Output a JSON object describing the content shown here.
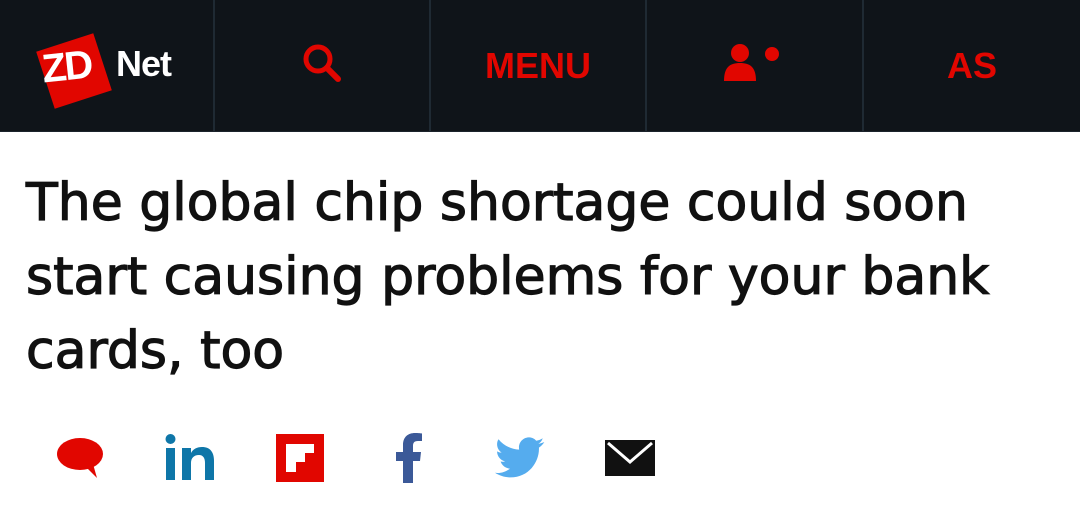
{
  "header": {
    "logo_text_zd": "ZD",
    "logo_text_net": "Net",
    "search_icon": "search-icon",
    "menu_label": "MENU",
    "user_icon": "user-icon",
    "edition_label": "AS",
    "brand_color": "#e10600",
    "background_color": "#0f1419"
  },
  "article": {
    "headline": "The global chip shortage could soon start causing problems for your bank cards, too"
  },
  "share": {
    "items": [
      {
        "icon": "comment-icon",
        "color": "#e10600"
      },
      {
        "icon": "linkedin-icon",
        "color": "#0e76a8"
      },
      {
        "icon": "flipboard-icon",
        "color": "#e10600"
      },
      {
        "icon": "facebook-icon",
        "color": "#3b5998"
      },
      {
        "icon": "twitter-icon",
        "color": "#55acee"
      },
      {
        "icon": "email-icon",
        "color": "#111111"
      }
    ]
  }
}
